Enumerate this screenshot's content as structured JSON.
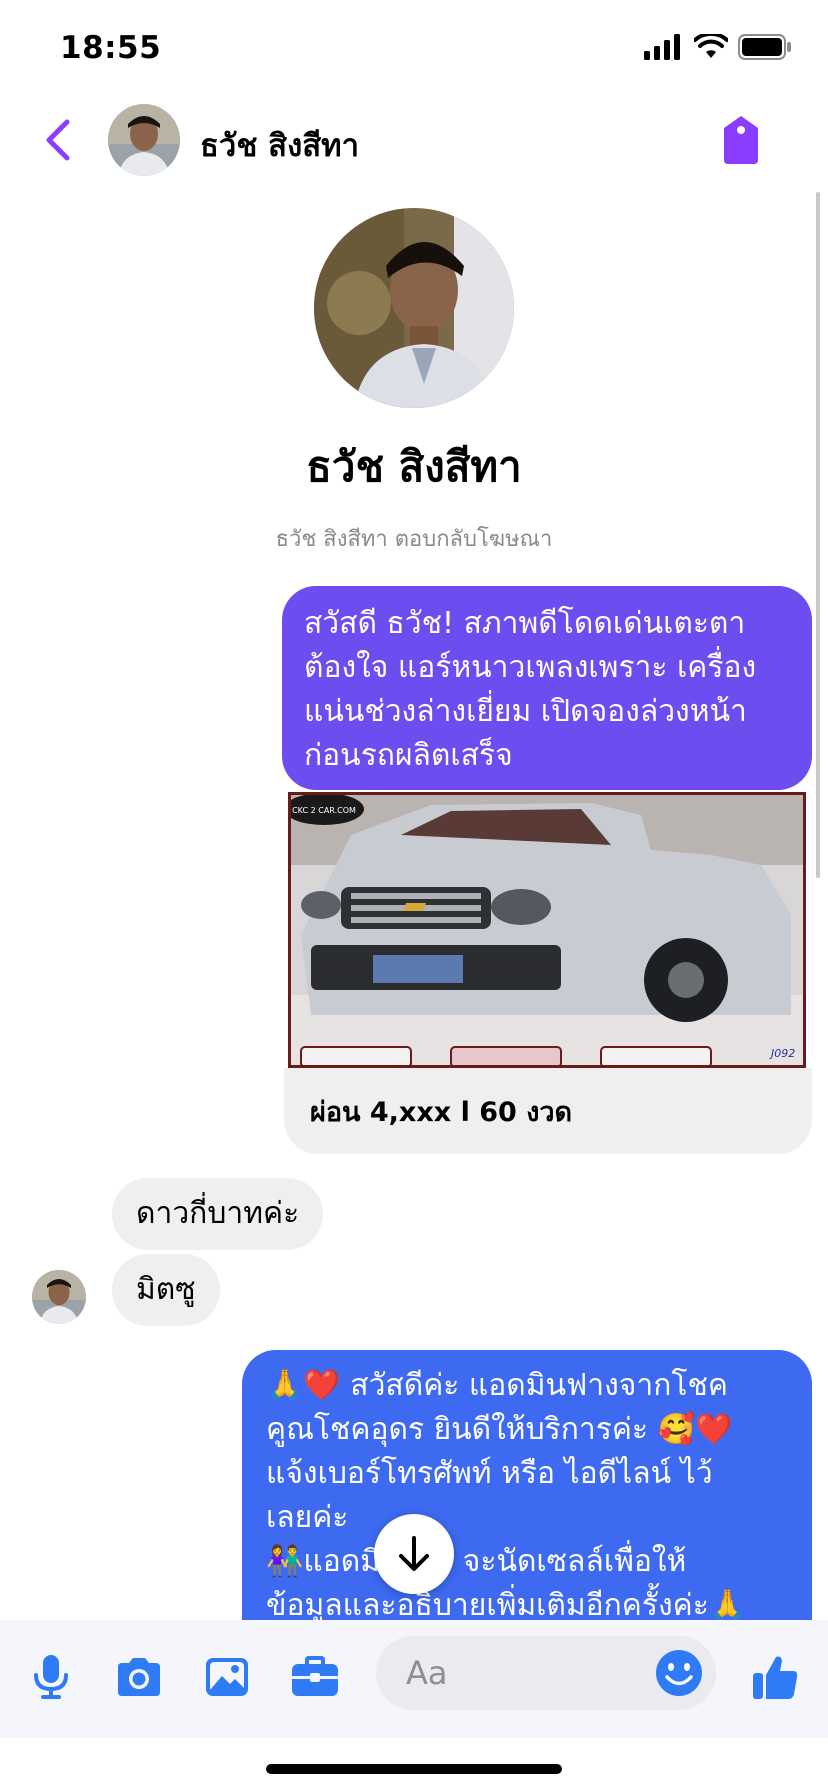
{
  "status_bar": {
    "time": "18:55"
  },
  "header": {
    "contact_name": "ธวัช สิงสีทา"
  },
  "profile": {
    "name": "ธวัช สิงสีทา",
    "subtitle": "ธวัช สิงสีทา ตอบกลับโฆษณา"
  },
  "messages": {
    "outgoing_1": {
      "lines": [
        "สวัสดี ธวัช! สภาพดีโดดเด่นเตะตา",
        "ต้องใจ แอร์หนาวเพลงเพราะ เครื่อง",
        "แน่นช่วงล่างเยี่ยม เปิดจองล่วงหน้า",
        "ก่อนรถผลิตเสร็จ"
      ]
    },
    "card": {
      "caption": "ผ่อน 4,xxx l 60 งวด",
      "image_watermark": "CKC 2 CAR.COM",
      "image_code": "J092"
    },
    "incoming_1": "ดาวกี่บาทค่ะ",
    "incoming_2": "มิตซู",
    "outgoing_2": {
      "line1_emoji": "🙏❤️",
      "line1_text": " สวัสดีค่ะ แอดมินฟางจากโชค",
      "line2_text": "คูณโชคอุดร ยินดีให้บริการค่ะ ",
      "line2_emoji": "🥰❤️",
      "line3": "แจ้งเบอร์โทรศัพท์ หรือ ไอดีไลน์  ไว้",
      "line4": "เลยค่ะ",
      "line5_emoji": "👫",
      "line5_text": "แอดมินฟาง จะนัดเซลล์เพื่อให้",
      "line6_text": "ข้อมูลและอธิบายเพิ่มเติมอีกครั้งค่ะ",
      "line6_emoji": "🙏"
    }
  },
  "composer": {
    "placeholder": "Aa"
  },
  "colors": {
    "accent_purple": "#8b3dff",
    "bubble_purple": "#6d4cf0",
    "bubble_blue": "#3e6af2",
    "icon_blue": "#2f7bf5",
    "bubble_gray": "#efeff0"
  }
}
